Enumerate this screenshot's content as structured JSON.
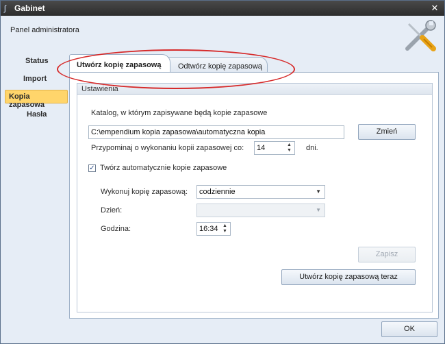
{
  "window": {
    "title": "Gabinet",
    "close_glyph": "✕",
    "app_icon": "stethoscope-icon"
  },
  "header": {
    "panel_title": "Panel administratora",
    "icon": "wrench-screwdriver-icon"
  },
  "nav": {
    "items": [
      {
        "label": "Status",
        "active": false
      },
      {
        "label": "Import",
        "active": false
      },
      {
        "label": "Kopia zapasowa",
        "active": true
      },
      {
        "label": "Hasła",
        "active": false
      }
    ]
  },
  "tabs": [
    {
      "label": "Utwórz kopię zapasową",
      "active": true
    },
    {
      "label": "Odtwórz kopię zapasową",
      "active": false
    }
  ],
  "settings": {
    "group_title": "Ustawienia",
    "catalog_label": "Katalog, w którym zapisywane będą kopie zapasowe",
    "catalog_path": "C:\\empendium kopia zapasowa\\automatyczna kopia",
    "change_button": "Zmień",
    "reminder_label": "Przypominaj o wykonaniu kopii zapasowej co:",
    "reminder_value": "14",
    "reminder_unit": "dni.",
    "auto_backup_label": "Twórz automatycznie kopie zapasowe",
    "auto_backup_checked": true,
    "perform_label": "Wykonuj kopię zapasową:",
    "perform_value": "codziennie",
    "day_label": "Dzień:",
    "day_value": "",
    "hour_label": "Godzina:",
    "hour_value": "16:34",
    "save_button": "Zapisz",
    "backup_now_button": "Utwórz kopię zapasową teraz"
  },
  "footer": {
    "ok_button": "OK"
  },
  "colors": {
    "accent_nav": "#ffd56b",
    "highlight": "#d62a2a",
    "titlebar": "#2c2c2c"
  }
}
